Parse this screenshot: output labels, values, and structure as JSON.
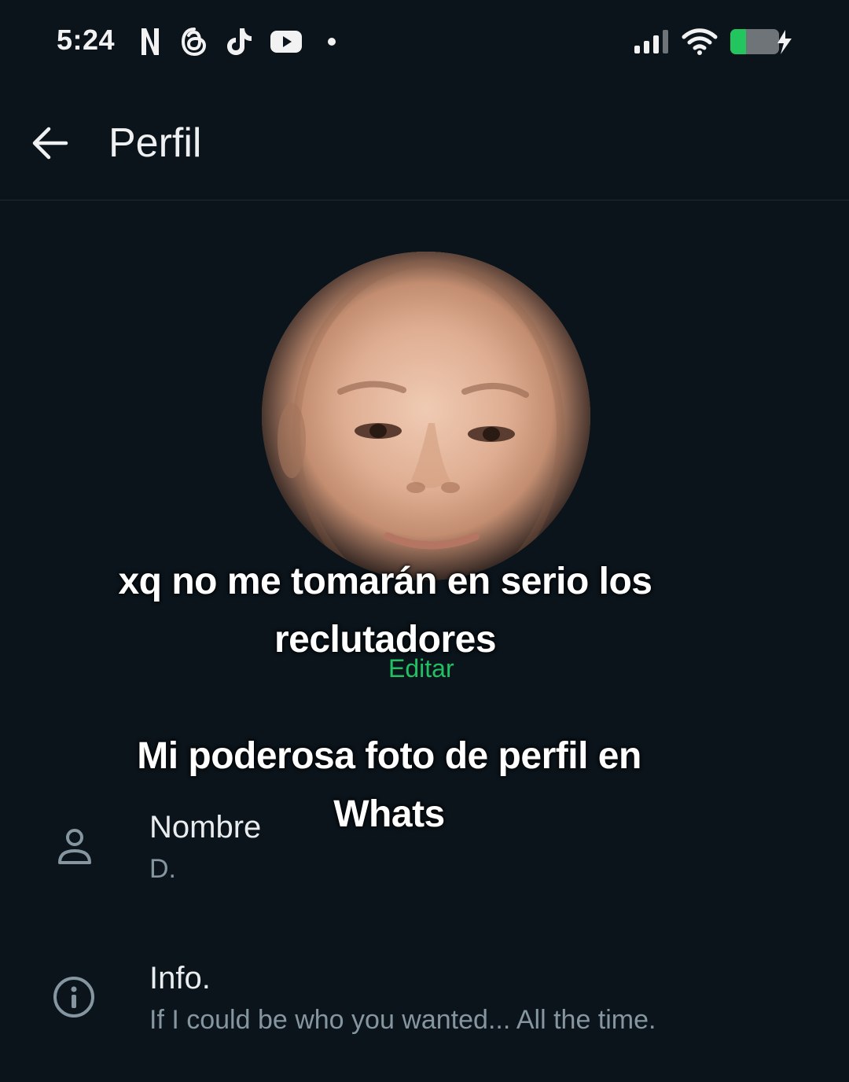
{
  "status_bar": {
    "time": "5:24",
    "icons": [
      "netflix-icon",
      "threads-icon",
      "tiktok-icon",
      "youtube-icon",
      "dot-icon",
      "signal-icon",
      "wifi-icon",
      "battery-charging-icon"
    ],
    "battery_color": "#22c55e"
  },
  "header": {
    "title": "Perfil",
    "back_icon": "arrow-left-icon"
  },
  "profile": {
    "edit_label": "Editar",
    "accent_color": "#21c063"
  },
  "overlay_captions": {
    "line1": "xq no me tomarán en serio los",
    "line2": "reclutadores",
    "line3": "Mi poderosa foto de perfil en",
    "line4": "Whats"
  },
  "rows": {
    "name": {
      "icon": "person-icon",
      "label": "Nombre",
      "value": "D."
    },
    "info": {
      "icon": "info-icon",
      "label": "Info.",
      "value": "If I could be who you wanted... All the time."
    }
  }
}
